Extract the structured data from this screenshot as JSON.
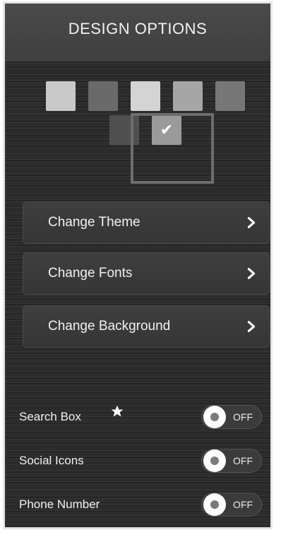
{
  "header": {
    "title": "DESIGN OPTIONS"
  },
  "swatches": [
    {
      "color": "#c9c9c9",
      "selected": false
    },
    {
      "color": "#6a6a6a",
      "selected": false
    },
    {
      "color": "#d4d4d4",
      "selected": false
    },
    {
      "color": "#a6a6a6",
      "selected": false
    },
    {
      "color": "#777777",
      "selected": false
    },
    {
      "color": "#505050",
      "selected": false
    },
    {
      "color": "#9a9a9a",
      "selected": true
    }
  ],
  "menu": {
    "items": [
      {
        "label": "Change Theme",
        "icon": "chevron-right-icon"
      },
      {
        "label": "Change Fonts",
        "icon": "chevron-right-icon"
      },
      {
        "label": "Change Background",
        "icon": "chevron-right-icon"
      }
    ]
  },
  "toggles": [
    {
      "label": "Search Box",
      "state": "OFF",
      "has_star": true
    },
    {
      "label": "Social Icons",
      "state": "OFF",
      "has_star": false
    },
    {
      "label": "Phone Number",
      "state": "OFF",
      "has_star": false
    }
  ],
  "icons": {
    "checkmark": "✔",
    "star": "star-icon"
  }
}
